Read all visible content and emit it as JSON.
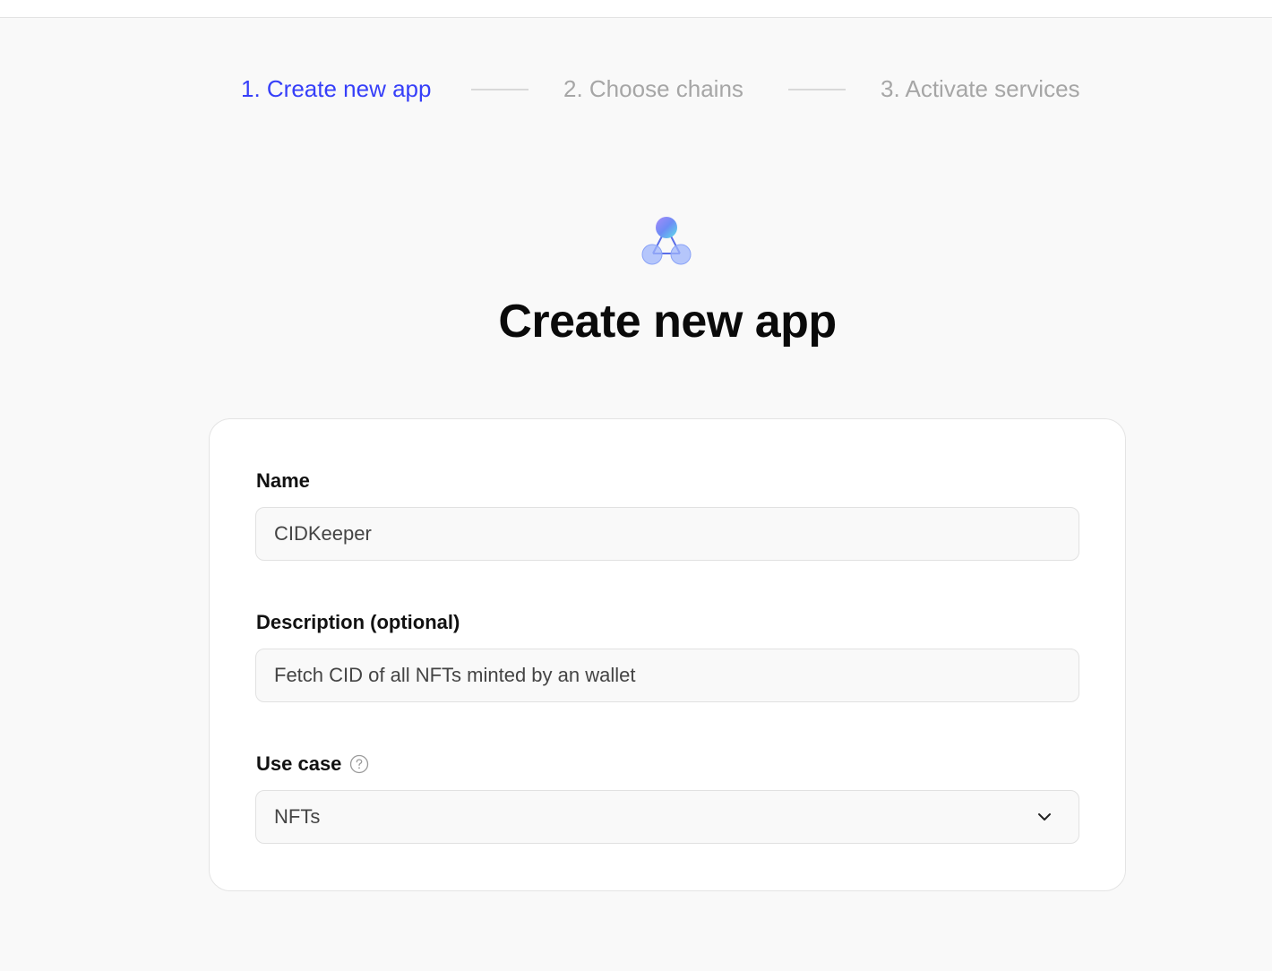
{
  "stepper": {
    "steps": [
      {
        "label": "1. Create new app",
        "state": "active"
      },
      {
        "label": "2. Choose chains",
        "state": "inactive"
      },
      {
        "label": "3. Activate services",
        "state": "inactive"
      }
    ],
    "active_color": "#363ff9",
    "inactive_color": "#a6a6a6"
  },
  "header": {
    "logo_icon": "molecule-nodes-icon",
    "title": "Create new app"
  },
  "form": {
    "name": {
      "label": "Name",
      "value": "CIDKeeper"
    },
    "description": {
      "label": "Description (optional)",
      "value": "Fetch CID of all NFTs minted by an wallet"
    },
    "use_case": {
      "label": "Use case",
      "help_icon": "question-circle-icon",
      "selected": "NFTs",
      "dropdown_icon": "chevron-down-icon"
    }
  }
}
